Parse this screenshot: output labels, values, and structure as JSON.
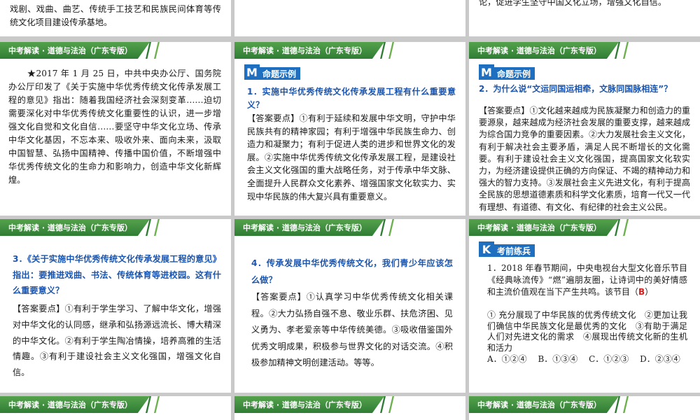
{
  "banner_text": "中考解读 · 道德与法治（广东专版）",
  "top_row": {
    "left_text": "校园统民族民间音乐、民族民间美术、民族民间舞蹈、戏剧、戏曲、曲艺、传统手工技艺和民族民间体育等传统文化项目建设传承基地。",
    "right_text": "论，促进学生坚守中国文化立场，增强文化自信。"
  },
  "slide_intro": {
    "text": "★2017 年 1 月 25 日，中共中央办公厅、国务院办公厅印发了《关于实施中华优秀传统文化传承发展工程的意见》指出：随着我国经济社会深刻变革……迫切需要深化对中华优秀传统文化重要性的认识，进一步增强文化自觉和文化自信……要坚守中华文化立场、传承中华文化基因，不忘本来、吸收外来、面向未来，汲取中国智慧、弘扬中国精神、传播中国价值，不断增强中华优秀传统文化的生命力和影响力，创造中华文化新辉煌。"
  },
  "slide_q1": {
    "tag_letter": "M",
    "tag_label": "命题示例",
    "question": "1．实施中华优秀传统文化传承发展工程有什么重要意义？",
    "answer": "【答案要点】①有利于延续和发展中华文明，守护中华民族共有的精神家园；有利于增强中华民族生命力、创造力和凝聚力；有利于促进人类的进步和世界文化的发展。②实施中华优秀传统文化传承发展工程，是建设社会主义文化强国的重大战略任务，对于传承中华文脉、全面提升人民群众文化素养、增强国家文化软实力、实现中华民族的伟大复兴具有重要意义。"
  },
  "slide_q2": {
    "tag_letter": "M",
    "tag_label": "命题示例",
    "question": "2．为什么说“文运同国运相牵，文脉同国脉相连”？",
    "answer": "【答案要点】①文化越来越成为民族凝聚力和创造力的重要源泉，越来越成为经济社会发展的重要支撑，越来越成为综合国力竞争的重要因素。②大力发展社会主义文化，有利于解决社会主要矛盾，满足人民不断增长的文化需要。有利于建设社会主义文化强国，提高国家文化软实力，为经济建设提供正确的方向保证、不竭的精神动力和强大的智力支持。③发展社会主义先进文化，有利于提高全民族的思想道德素质和科学文化素质，培育一代又一代有理想、有道德、有文化、有纪律的社会主义公民。"
  },
  "slide_q3": {
    "question": "3．《关于实施中华优秀传统文化传承发展工程的意见》指出：要推进戏曲、书法、传统体育等进校园。这有什么重要意义？",
    "answer": "【答案要点】①有利于学生学习、了解中华文化，增强对中华文化的认同感，继承和弘扬源远流长、博大精深的中华文化。②有利于学生陶冶情操，培养高雅的生活情趣。③有利于建设社会主义文化强国，增强文化自信。"
  },
  "slide_q4": {
    "question": "4．传承发展中华优秀传统文化，我们青少年应该怎么做？",
    "answer": "【答案要点】①认真学习中华优秀传统文化相关课程。②大力弘扬自强不息、敬业乐群、扶危济困、见义勇为、孝老爱亲等中华传统美德。③吸收借鉴国外优秀文明成果，积极参与世界文化的对话交流。④积极参加精神文明创建活动。等等。"
  },
  "slide_practice": {
    "tag_letter": "K",
    "tag_label": "考前练兵",
    "stem_before": "1．2018 年春节期间，中央电视台大型文化音乐节目《经典咏流传》“燃”遍朋友圈，让诗词中的美好情感和主流价值观在当下产生共鸣。该节目（",
    "answer_letter": "B",
    "stem_after": "）",
    "statements": "① 充分展现了中华民族的优秀传统文化　②更加让我们确信中华民族文化是最优秀的文化　③有助于满足人们对先进文化的需求　④展现出传统文化新的生机和活力",
    "options": "A．①②④　 B．①③④　 C．①②③　 D．②③④"
  },
  "colors": {
    "banner_green": "#2f7d35",
    "tag_blue": "#1f6fc0",
    "question_blue": "#1a55b0",
    "answer_red": "#d21f1f",
    "gap_gray": "#c9c9c9"
  }
}
